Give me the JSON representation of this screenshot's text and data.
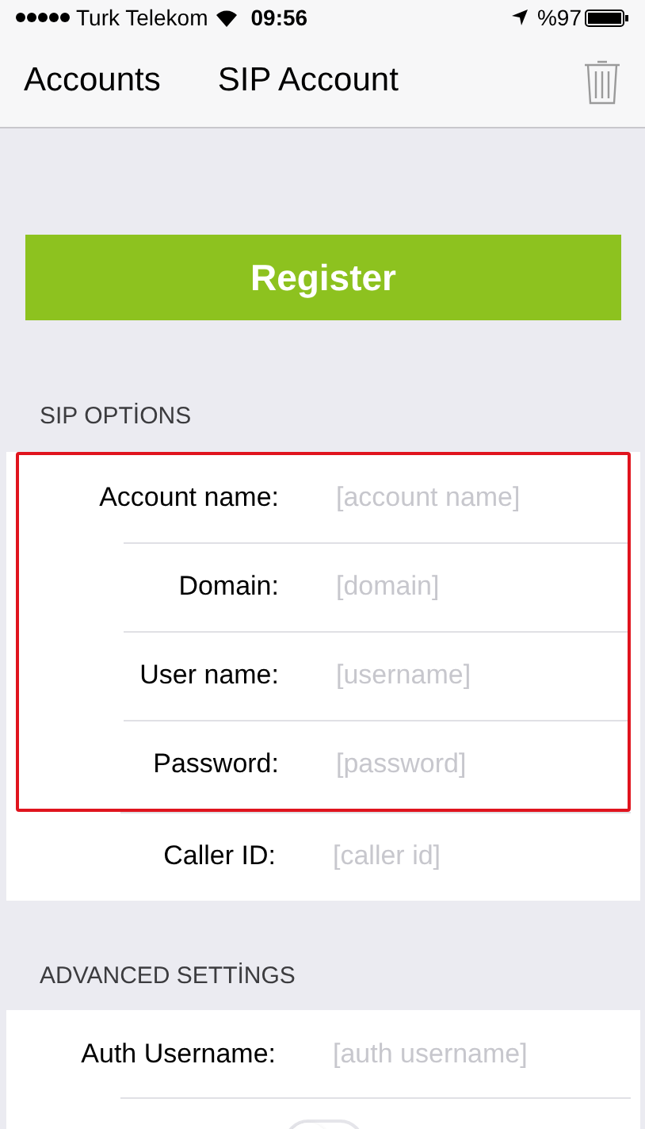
{
  "status_bar": {
    "carrier": "Turk Telekom",
    "time": "09:56",
    "battery": "%97"
  },
  "nav": {
    "back": "Accounts",
    "title": "SIP Account"
  },
  "register_button": "Register",
  "sections": [
    {
      "header": "SIP OPTİONS",
      "fields": [
        {
          "kind": "text",
          "label": "Account name:",
          "placeholder": "[account name]",
          "highlighted": true
        },
        {
          "kind": "text",
          "label": "Domain:",
          "placeholder": "[domain]",
          "highlighted": true
        },
        {
          "kind": "text",
          "label": "User name:",
          "placeholder": "[username]",
          "highlighted": true
        },
        {
          "kind": "text",
          "label": "Password:",
          "placeholder": "[password]",
          "highlighted": true
        },
        {
          "kind": "text",
          "label": "Caller ID:",
          "placeholder": "[caller id]",
          "highlighted": false
        }
      ]
    },
    {
      "header": "ADVANCED SETTİNGS",
      "fields": [
        {
          "kind": "text",
          "label": "Auth Username:",
          "placeholder": "[auth username]",
          "highlighted": false
        },
        {
          "kind": "switch",
          "on": false,
          "highlighted": false
        }
      ]
    }
  ]
}
